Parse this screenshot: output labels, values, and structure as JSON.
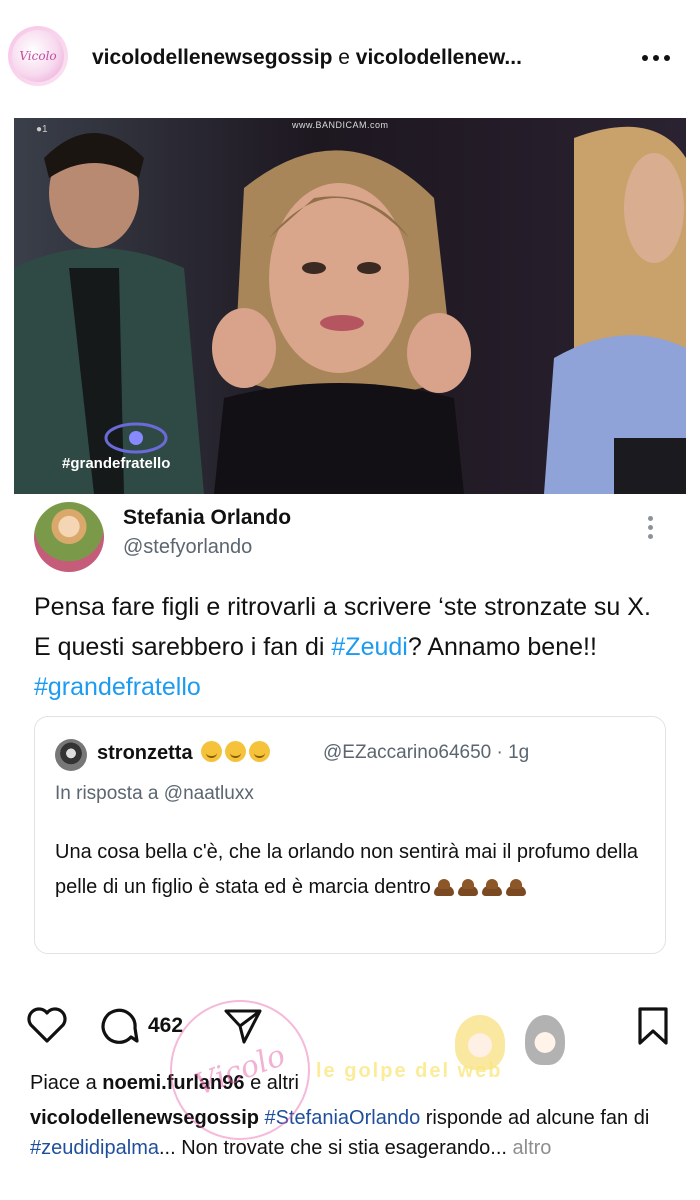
{
  "header": {
    "username": "vicolodellenewsegossip",
    "connector": "e",
    "collaborator": "vicolodellenew...",
    "avatar_text": "Vicolo"
  },
  "media": {
    "hashtag": "#grandefratello",
    "watermark": "www.BANDICAM.com"
  },
  "tweet": {
    "name": "Stefania Orlando",
    "handle": "@stefyorlando",
    "text_before": "Pensa fare figli e ritrovarli a scrivere ‘ste stronzate su X. E questi sarebbero i fan di ",
    "tag1": "#Zeudi",
    "text_middle": "? Annamo bene!! ",
    "tag2": "#grandefratello",
    "quote": {
      "name": "stronzetta",
      "handle": "@EZaccarino64650 · 1g",
      "reply_to": "In risposta a @naatluxx",
      "text": "Una cosa bella c'è, che la orlando non sentirà mai il profumo della pelle di un figlio è stata ed è marcia dentro"
    }
  },
  "actions": {
    "comment_count": "462"
  },
  "likes": {
    "prefix": "Piace a ",
    "user": "noemi.furlan96",
    "suffix": " e altri"
  },
  "caption": {
    "username": "vicolodellenewsegossip",
    "tag1": "#StefaniaOrlando",
    "text1": " risponde ad alcune fan di ",
    "tag2": "#zeudidipalma",
    "text2": "... Non trovate che si stia esagerando...",
    "more": " altro"
  },
  "overlay": {
    "circle_text": "Vicolo",
    "banner_text": "le golpe del web"
  },
  "colors": {
    "link_blue": "#1d9bf0",
    "caption_tag": "#1f4f9c",
    "muted": "#5b6670"
  }
}
